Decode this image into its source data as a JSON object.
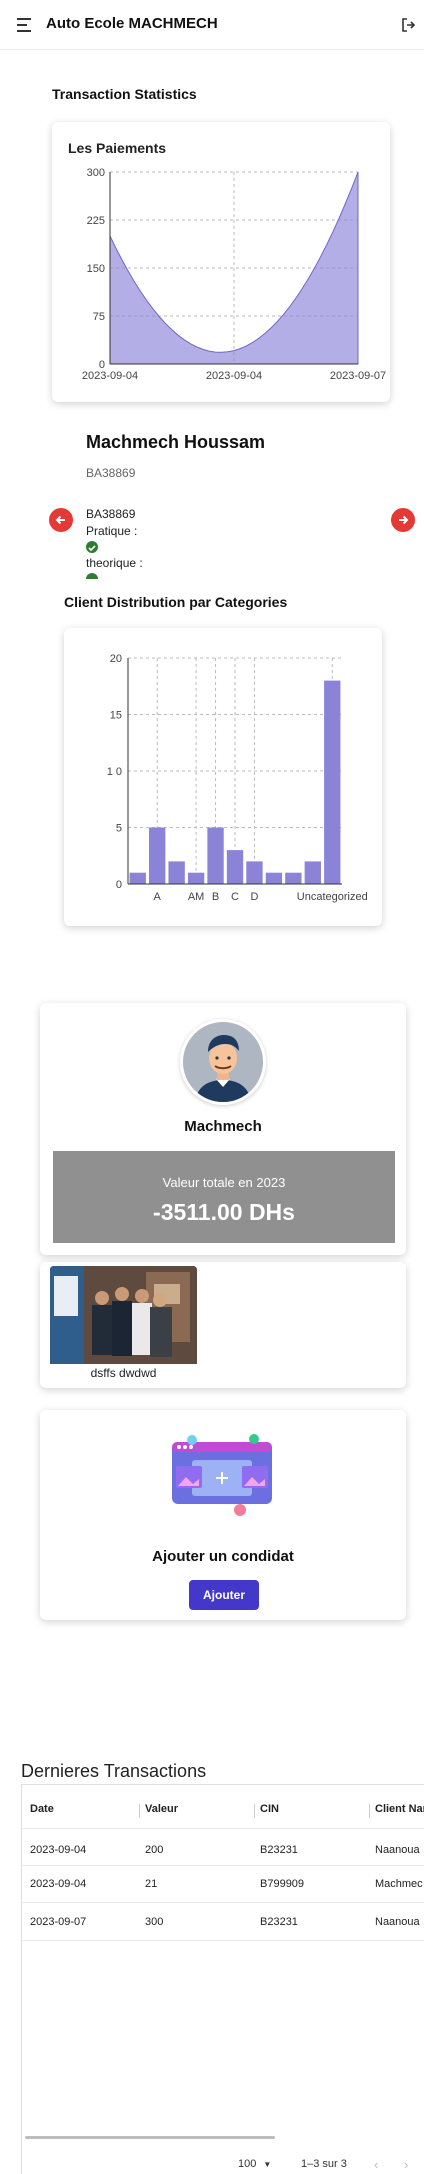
{
  "header": {
    "title": "Auto Ecole MACHMECH",
    "menu_icon": "menu-icon",
    "logout_icon": "logout-icon"
  },
  "transaction_stats": {
    "section_title": "Transaction Statistics",
    "chart_title": "Les Paiements"
  },
  "chart_data": [
    {
      "type": "area",
      "title": "Les Paiements",
      "x": [
        "2023-09-04",
        "2023-09-04",
        "2023-09-07"
      ],
      "values": [
        200,
        21,
        300
      ],
      "yticks": [
        0,
        75,
        150,
        225,
        300
      ],
      "ylim": [
        0,
        300
      ],
      "grid": true,
      "color": "#8b83d8"
    },
    {
      "type": "bar",
      "title": "Client Distribution par Categories",
      "categories": [
        "",
        "A",
        "",
        "AM",
        "B",
        "C",
        "D",
        "",
        "",
        "",
        "Uncategorized"
      ],
      "values": [
        1,
        5,
        2,
        1,
        5,
        3,
        2,
        1,
        1,
        2,
        18
      ],
      "yticks": [
        0,
        5,
        10,
        15,
        20
      ],
      "ytick_labels": [
        "0",
        "5",
        "1 0",
        "15",
        "20"
      ],
      "ylim": [
        0,
        20
      ],
      "grid": true,
      "color": "#8b83d8"
    }
  ],
  "profile": {
    "name": "Machmech Houssam",
    "cin": "BA38869",
    "slide_cin": "BA38869",
    "pratique_label": "Pratique :",
    "theorique_label": "theorique :",
    "status_color": "#2e7d32"
  },
  "distribution": {
    "section_title": "Client Distribution par Categories"
  },
  "user_card": {
    "name": "Machmech",
    "value_label": "Valeur totale en 2023",
    "value_amount": "-3511.00 DHs"
  },
  "photo_card": {
    "caption": "dsffs dwdwd"
  },
  "add_card": {
    "title": "Ajouter un condidat",
    "button_label": "Ajouter"
  },
  "transactions": {
    "title": "Dernieres Transactions",
    "columns": [
      "Date",
      "Valeur",
      "CIN",
      "Client Nam"
    ],
    "rows": [
      [
        "2023-09-04",
        "200",
        "B23231",
        "Naanoua"
      ],
      [
        "2023-09-04",
        "21",
        "B799909",
        "Machmec"
      ],
      [
        "2023-09-07",
        "300",
        "B23231",
        "Naanoua"
      ]
    ],
    "page_size": "100",
    "pagination": "1–3 sur 3"
  }
}
